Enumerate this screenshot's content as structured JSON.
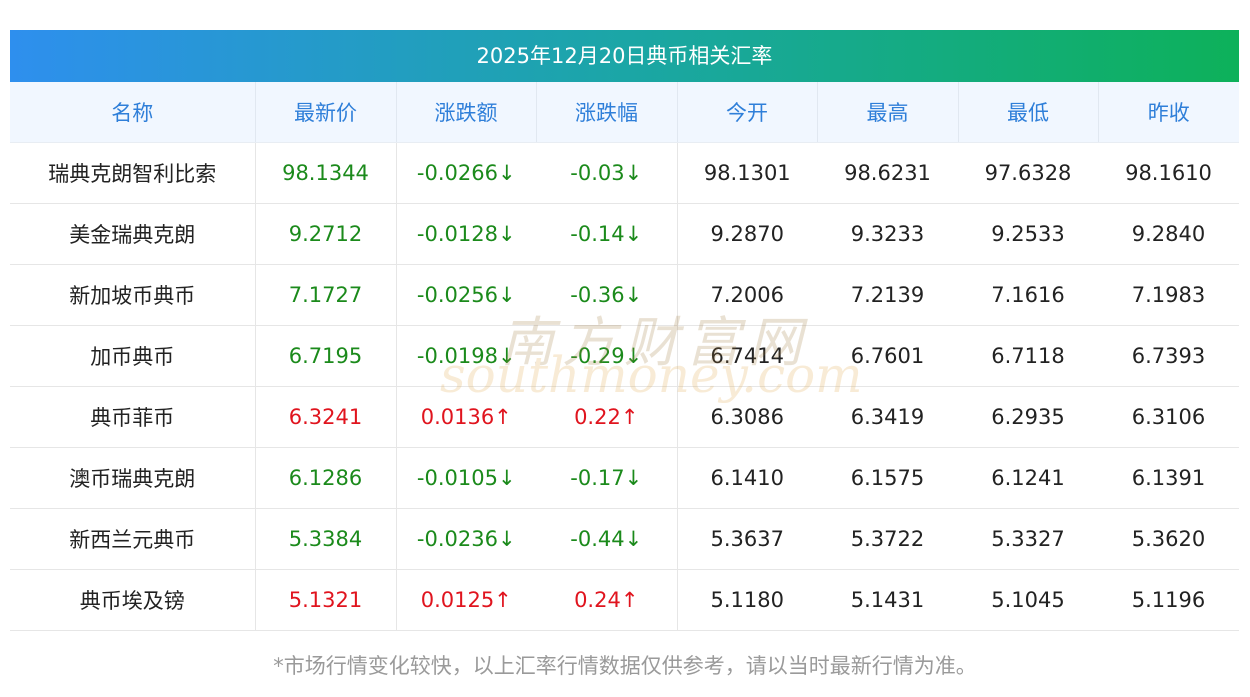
{
  "title": "2025年12月20日典币相关汇率",
  "columns": [
    "名称",
    "最新价",
    "涨跌额",
    "涨跌幅",
    "今开",
    "最高",
    "最低",
    "昨收"
  ],
  "rows": [
    {
      "name": "瑞典克朗智利比索",
      "latest": "98.1344",
      "change": "-0.0266↓",
      "pct": "-0.03↓",
      "open": "98.1301",
      "high": "98.6231",
      "low": "97.6328",
      "prev": "98.1610",
      "trend": "down"
    },
    {
      "name": "美金瑞典克朗",
      "latest": "9.2712",
      "change": "-0.0128↓",
      "pct": "-0.14↓",
      "open": "9.2870",
      "high": "9.3233",
      "low": "9.2533",
      "prev": "9.2840",
      "trend": "down"
    },
    {
      "name": "新加坡币典币",
      "latest": "7.1727",
      "change": "-0.0256↓",
      "pct": "-0.36↓",
      "open": "7.2006",
      "high": "7.2139",
      "low": "7.1616",
      "prev": "7.1983",
      "trend": "down"
    },
    {
      "name": "加币典币",
      "latest": "6.7195",
      "change": "-0.0198↓",
      "pct": "-0.29↓",
      "open": "6.7414",
      "high": "6.7601",
      "low": "6.7118",
      "prev": "6.7393",
      "trend": "down"
    },
    {
      "name": "典币菲币",
      "latest": "6.3241",
      "change": "0.0136↑",
      "pct": "0.22↑",
      "open": "6.3086",
      "high": "6.3419",
      "low": "6.2935",
      "prev": "6.3106",
      "trend": "up"
    },
    {
      "name": "澳币瑞典克朗",
      "latest": "6.1286",
      "change": "-0.0105↓",
      "pct": "-0.17↓",
      "open": "6.1410",
      "high": "6.1575",
      "low": "6.1241",
      "prev": "6.1391",
      "trend": "down"
    },
    {
      "name": "新西兰元典币",
      "latest": "5.3384",
      "change": "-0.0236↓",
      "pct": "-0.44↓",
      "open": "5.3637",
      "high": "5.3722",
      "low": "5.3327",
      "prev": "5.3620",
      "trend": "down"
    },
    {
      "name": "典币埃及镑",
      "latest": "5.1321",
      "change": "0.0125↑",
      "pct": "0.24↑",
      "open": "5.1180",
      "high": "5.1431",
      "low": "5.1045",
      "prev": "5.1196",
      "trend": "up"
    }
  ],
  "note": "*市场行情变化较快，以上汇率行情数据仅供参考，请以当时最新行情为准。",
  "watermark": {
    "cn": "南方财富网",
    "en": "southmoney.com"
  },
  "colors": {
    "up": "#e0141e",
    "down": "#1b8a1b",
    "header_text": "#2f7fd9"
  }
}
